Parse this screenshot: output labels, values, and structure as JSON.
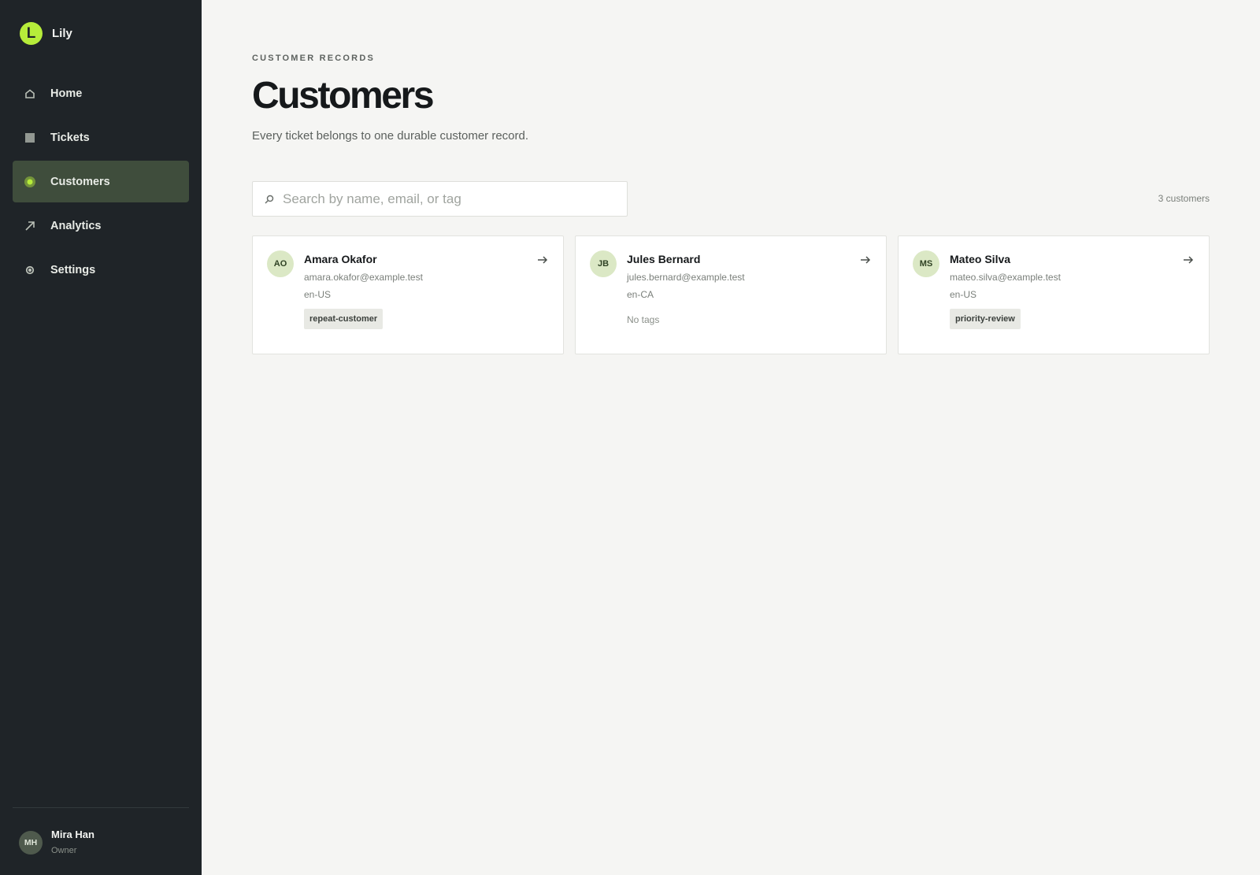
{
  "brand": {
    "logo_letter": "L",
    "name": "Lily",
    "accent": "#b6ec3a"
  },
  "nav": {
    "items": [
      {
        "label": "Home",
        "icon": "home-icon",
        "active": false
      },
      {
        "label": "Tickets",
        "icon": "tickets-icon",
        "active": false
      },
      {
        "label": "Customers",
        "icon": "customers-icon",
        "active": true
      },
      {
        "label": "Analytics",
        "icon": "analytics-icon",
        "active": false
      },
      {
        "label": "Settings",
        "icon": "settings-icon",
        "active": false
      }
    ]
  },
  "user": {
    "initials": "MH",
    "name": "Mira Han",
    "role": "Owner"
  },
  "page": {
    "eyebrow": "CUSTOMER RECORDS",
    "title": "Customers",
    "subtitle": "Every ticket belongs to one durable customer record."
  },
  "search": {
    "placeholder": "Search by name, email, or tag",
    "value": ""
  },
  "count_label": "3 customers",
  "customers": [
    {
      "initials": "AO",
      "name": "Amara Okafor",
      "email": "amara.okafor@example.test",
      "locale": "en-US",
      "tag": "repeat-customer",
      "no_tags_label": ""
    },
    {
      "initials": "JB",
      "name": "Jules Bernard",
      "email": "jules.bernard@example.test",
      "locale": "en-CA",
      "tag": "",
      "no_tags_label": "No tags"
    },
    {
      "initials": "MS",
      "name": "Mateo Silva",
      "email": "mateo.silva@example.test",
      "locale": "en-US",
      "tag": "priority-review",
      "no_tags_label": ""
    }
  ]
}
